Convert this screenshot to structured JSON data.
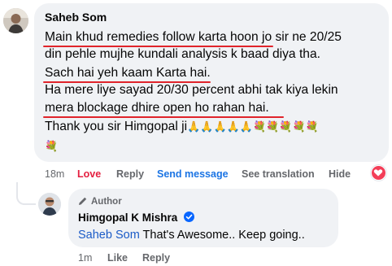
{
  "comment": {
    "author": "Saheb Som",
    "lines": {
      "l1_underlined": "Main khud remedies follow karta hoon",
      "l1_rest": " jo sir ne 20/25",
      "l2": "din pehle mujhe kundali analysis k baad diya tha.",
      "l3": "Sach hai yeh kaam Karta hai.",
      "l4": "Ha mere liye sayad 20/30 percent abhi tak kiya lekin",
      "l5": "mera blockage dhire open ho rahan hai.",
      "l6": "Thank you sir Himgopal ji"
    },
    "emojis": {
      "pray": "🙏",
      "flower": "💐",
      "pray_count": 5,
      "flower_count": 6
    },
    "meta": {
      "time": "18m",
      "reaction": "Love",
      "reply": "Reply",
      "send_message": "Send message",
      "see_translation": "See translation",
      "hide": "Hide"
    }
  },
  "reply": {
    "badge": "Author",
    "author": "Himgopal K Mishra",
    "mention": "Saheb Som",
    "text": " That's Awesome.. Keep going..",
    "meta": {
      "time": "1m",
      "like": "Like",
      "reply": "Reply"
    }
  },
  "colors": {
    "underline": "#e0242b",
    "bubble": "#f0f2f5",
    "send_message": "#1b74e4",
    "love": "#e41e3f",
    "mention": "#1b5bc7",
    "verified": "#0866ff"
  },
  "icons": [
    "user-avatar-icon",
    "pen-icon",
    "verified-badge-icon",
    "heart-reaction-icon"
  ]
}
